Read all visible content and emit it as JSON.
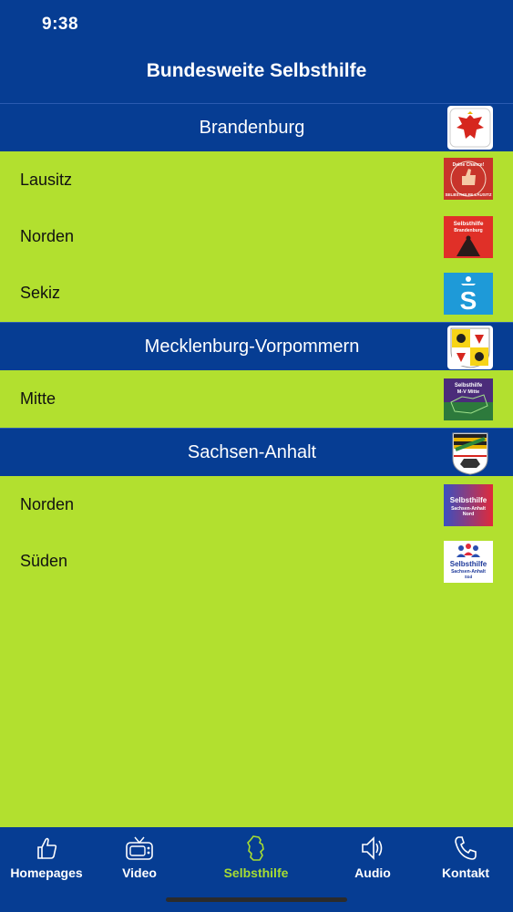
{
  "status": {
    "time": "9:38"
  },
  "header": {
    "title": "Bundesweite Selbsthilfe"
  },
  "sections": [
    {
      "title": "Brandenburg",
      "crest_icon": "brandenburg-eagle-icon",
      "items": [
        {
          "label": "Lausitz",
          "logo_icon": "thumbs-up-logo-icon",
          "logo_text": "Deine Chance! SELBSTHILFE LAUSITZ"
        },
        {
          "label": "Norden",
          "logo_icon": "selbsthilfe-brandenburg-logo-icon",
          "logo_text": "Selbsthilfe Brandenburg"
        },
        {
          "label": "Sekiz",
          "logo_icon": "sekiz-logo-icon",
          "logo_text": "S"
        }
      ]
    },
    {
      "title": "Mecklenburg-Vorpommern",
      "crest_icon": "mv-coat-of-arms-icon",
      "items": [
        {
          "label": "Mitte",
          "logo_icon": "selbsthilfe-mv-mitte-logo-icon",
          "logo_text": "Selbsthilfe M-V Mitte"
        }
      ]
    },
    {
      "title": "Sachsen-Anhalt",
      "crest_icon": "sachsen-anhalt-coat-of-arms-icon",
      "items": [
        {
          "label": "Norden",
          "logo_icon": "selbsthilfe-sachsen-anhalt-nord-logo-icon",
          "logo_text": "Selbsthilfe Sachsen-Anhalt Nord"
        },
        {
          "label": "Süden",
          "logo_icon": "selbsthilfe-sachsen-anhalt-sued-logo-icon",
          "logo_text": "Selbsthilfe Sachsen-Anhalt Süd"
        }
      ]
    }
  ],
  "tabs": [
    {
      "label": "Homepages",
      "icon": "thumbs-up-icon",
      "active": false
    },
    {
      "label": "Video",
      "icon": "tv-icon",
      "active": false
    },
    {
      "label": "Selbsthilfe",
      "icon": "germany-map-icon",
      "active": true
    },
    {
      "label": "Audio",
      "icon": "speaker-icon",
      "active": false
    },
    {
      "label": "Kontakt",
      "icon": "phone-icon",
      "active": false
    }
  ],
  "colors": {
    "primary_blue": "#063d93",
    "list_green": "#b2e02f",
    "active_tab": "#a6dc32"
  }
}
